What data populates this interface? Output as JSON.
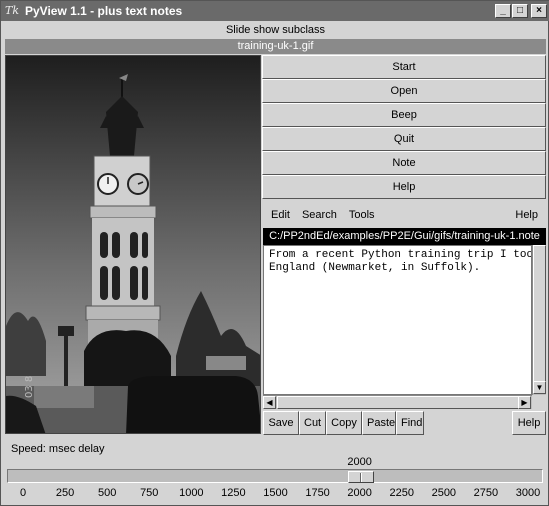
{
  "window": {
    "title": "PyView 1.1 - plus text notes",
    "icon_glyph": "Tk",
    "controls": {
      "minimize": "_",
      "maximize": "□",
      "close": "×"
    }
  },
  "subtitle": "Slide show subclass",
  "image_filename": "training-uk-1.gif",
  "buttons": [
    "Start",
    "Open",
    "Beep",
    "Quit",
    "Note",
    "Help"
  ],
  "note_menu": {
    "edit": "Edit",
    "search": "Search",
    "tools": "Tools",
    "help": "Help"
  },
  "note_path": "C:/PP2ndEd/examples/PP2E/Gui/gifs/training-uk-1.note",
  "note_text": "From a recent Python training trip I took t\nEngland (Newmarket, in Suffolk).",
  "note_toolbar": {
    "save": "Save",
    "cut": "Cut",
    "copy": "Copy",
    "paste": "Paste",
    "find": "Find",
    "help": "Help"
  },
  "speed": {
    "label": "Speed: msec delay",
    "value": "2000",
    "min": 0,
    "max": 3000,
    "ticks": [
      "0",
      "250",
      "500",
      "750",
      "1000",
      "1250",
      "1500",
      "1750",
      "2000",
      "2250",
      "2500",
      "2750",
      "3000"
    ]
  },
  "photo": {
    "stamp_text": "03 8"
  },
  "colors": {
    "titlebar": "#6a6a6a",
    "path_bar": "#000000",
    "filename_bar": "#8a8a8a"
  }
}
